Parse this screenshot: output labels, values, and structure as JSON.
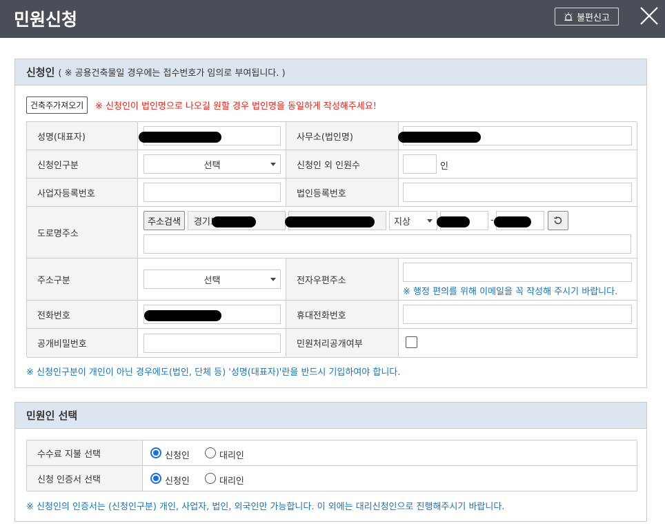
{
  "window": {
    "title": "민원신청",
    "report_label": "불편신고"
  },
  "applicant": {
    "heading": "신청인",
    "heading_note": "( ※ 공용건축물일 경우에는 접수번호가 임의로 부여됩니다. )",
    "pull_button": "건축주가져오기",
    "red_note": "※ 신청인이 법인명으로 나오길 원할 경우 법인명을 동일하게 작성해주세요!",
    "labels": {
      "name": "성명(대표자)",
      "office": "사무소(법인명)",
      "type": "신청인구분",
      "other_count": "신청인 외 인원수",
      "biz_no": "사업자등록번호",
      "corp_no": "법인등록번호",
      "road_address": "도로명주소",
      "address_type": "주소구분",
      "email": "전자우편주소",
      "phone": "전화번호",
      "mobile": "휴대전화번호",
      "password": "공개비밀번호",
      "disclose": "민원처리공개여부"
    },
    "type_select": "선택",
    "person_unit": "인",
    "address_search": "주소검색",
    "address_prefix": "경기도",
    "address_ground": "지상",
    "address_dash": "-",
    "address_type_select": "선택",
    "email_note": "※ 행정 편의를 위해 이메일을 꼭 작성해 주시기 바랍니다.",
    "bottom_note": "※ 신청인구분이 개인이 아닌 경우에도(법인, 단체 등) '성명(대표자)'란을 반드시 기입하여야 합니다."
  },
  "agent": {
    "heading": "민원인 선택",
    "fee_label": "수수료 지불 선택",
    "cert_label": "신청 인증서 선택",
    "opt_applicant": "신청인",
    "opt_agent": "대리인",
    "fee_selected": "신청인",
    "cert_selected": "신청인",
    "note": "※ 신청인의 인증서는 (신청인구분) 개인, 사업자, 법인, 외국인만 가능합니다. 이 외에는 대리신청인으로 진행해주시기 바랍니다."
  }
}
